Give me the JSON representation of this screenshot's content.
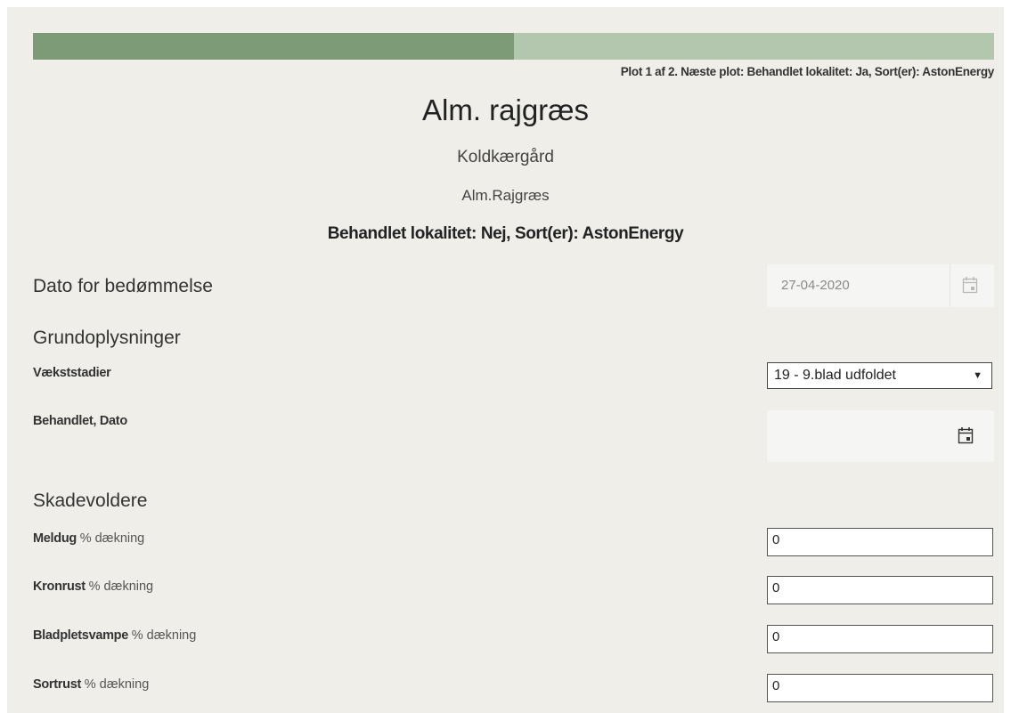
{
  "progress": {
    "fraction": 0.5
  },
  "plot_info": "Plot 1 af 2. Næste plot: Behandlet lokalitet: Ja, Sort(er): AstonEnergy",
  "header": {
    "title": "Alm. rajgræs",
    "location": "Koldkærgård",
    "crop": "Alm.Rajgræs",
    "treatment": "Behandlet lokalitet: Nej, Sort(er): AstonEnergy"
  },
  "assessment_date": {
    "label": "Dato for bedømmelse",
    "value": "27-04-2020",
    "icon": "calendar-icon"
  },
  "basic_info": {
    "heading": "Grundoplysninger",
    "growth_stage": {
      "label": "Vækststadier",
      "selected": "19 - 9.blad udfoldet"
    },
    "treated_date": {
      "label": "Behandlet, Dato",
      "value": "",
      "icon": "calendar-icon"
    }
  },
  "pests": {
    "heading": "Skadevoldere",
    "unit": "% dækning",
    "items": [
      {
        "name": "Meldug",
        "value": "0"
      },
      {
        "name": "Kronrust",
        "value": "0"
      },
      {
        "name": "Bladpletsvampe",
        "value": "0"
      },
      {
        "name": "Sortrust",
        "value": "0"
      }
    ]
  },
  "colors": {
    "progress_fill": "#7d9b77",
    "progress_track": "#b3c7ae",
    "panel_bg": "#efeee9"
  }
}
